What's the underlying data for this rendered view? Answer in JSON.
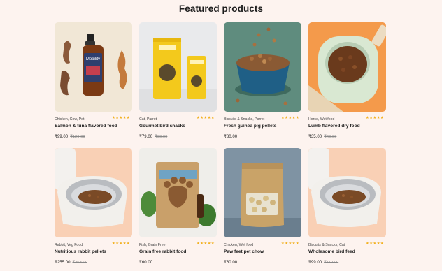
{
  "section": {
    "title": "Featured products"
  },
  "products": [
    {
      "tags": "Chicken, Cow, Pet",
      "name": "Salmon & tuna flavored food",
      "price": "₹99.00",
      "old_price": "₹120.00",
      "rating": 5,
      "image": "supplement-bottle-with-chews",
      "label_text": "Mobility"
    },
    {
      "tags": "Cat, Parrot",
      "name": "Gourmet bird snacks",
      "price": "₹79.00",
      "old_price": "₹90.00",
      "rating": 5,
      "image": "yellow-snack-bags"
    },
    {
      "tags": "Biscuits & Snacks, Parrot",
      "name": "Fresh guinea pig pellets",
      "price": "₹80.00",
      "old_price": "",
      "rating": 5,
      "image": "blue-bowl-kibble"
    },
    {
      "tags": "Horse, Wet food",
      "name": "Lumb flavored dry food",
      "price": "₹35.00",
      "old_price": "₹40.00",
      "rating": 5,
      "image": "feeder-bowl-orange"
    },
    {
      "tags": "Rabbit, Veg Food",
      "name": "Nutritious rabbit pellets",
      "price": "₹255.00",
      "old_price": "₹263.00",
      "rating": 5,
      "image": "automatic-feeder"
    },
    {
      "tags": "Fish, Grain Free",
      "name": "Grain free rabbit food",
      "price": "₹60.00",
      "old_price": "",
      "rating": 5,
      "image": "treat-pouch-paw"
    },
    {
      "tags": "Chicken, Wet food",
      "name": "Paw feet pet chow",
      "price": "₹60.00",
      "old_price": "",
      "rating": 5,
      "image": "kraft-pouch"
    },
    {
      "tags": "Biscuits & Snacks, Cat",
      "name": "Wholesome bird feed",
      "price": "₹99.00",
      "old_price": "₹110.00",
      "rating": 5,
      "image": "automatic-feeder"
    }
  ],
  "colors": {
    "background": "#fdf3ef",
    "star": "#f2b01e"
  }
}
